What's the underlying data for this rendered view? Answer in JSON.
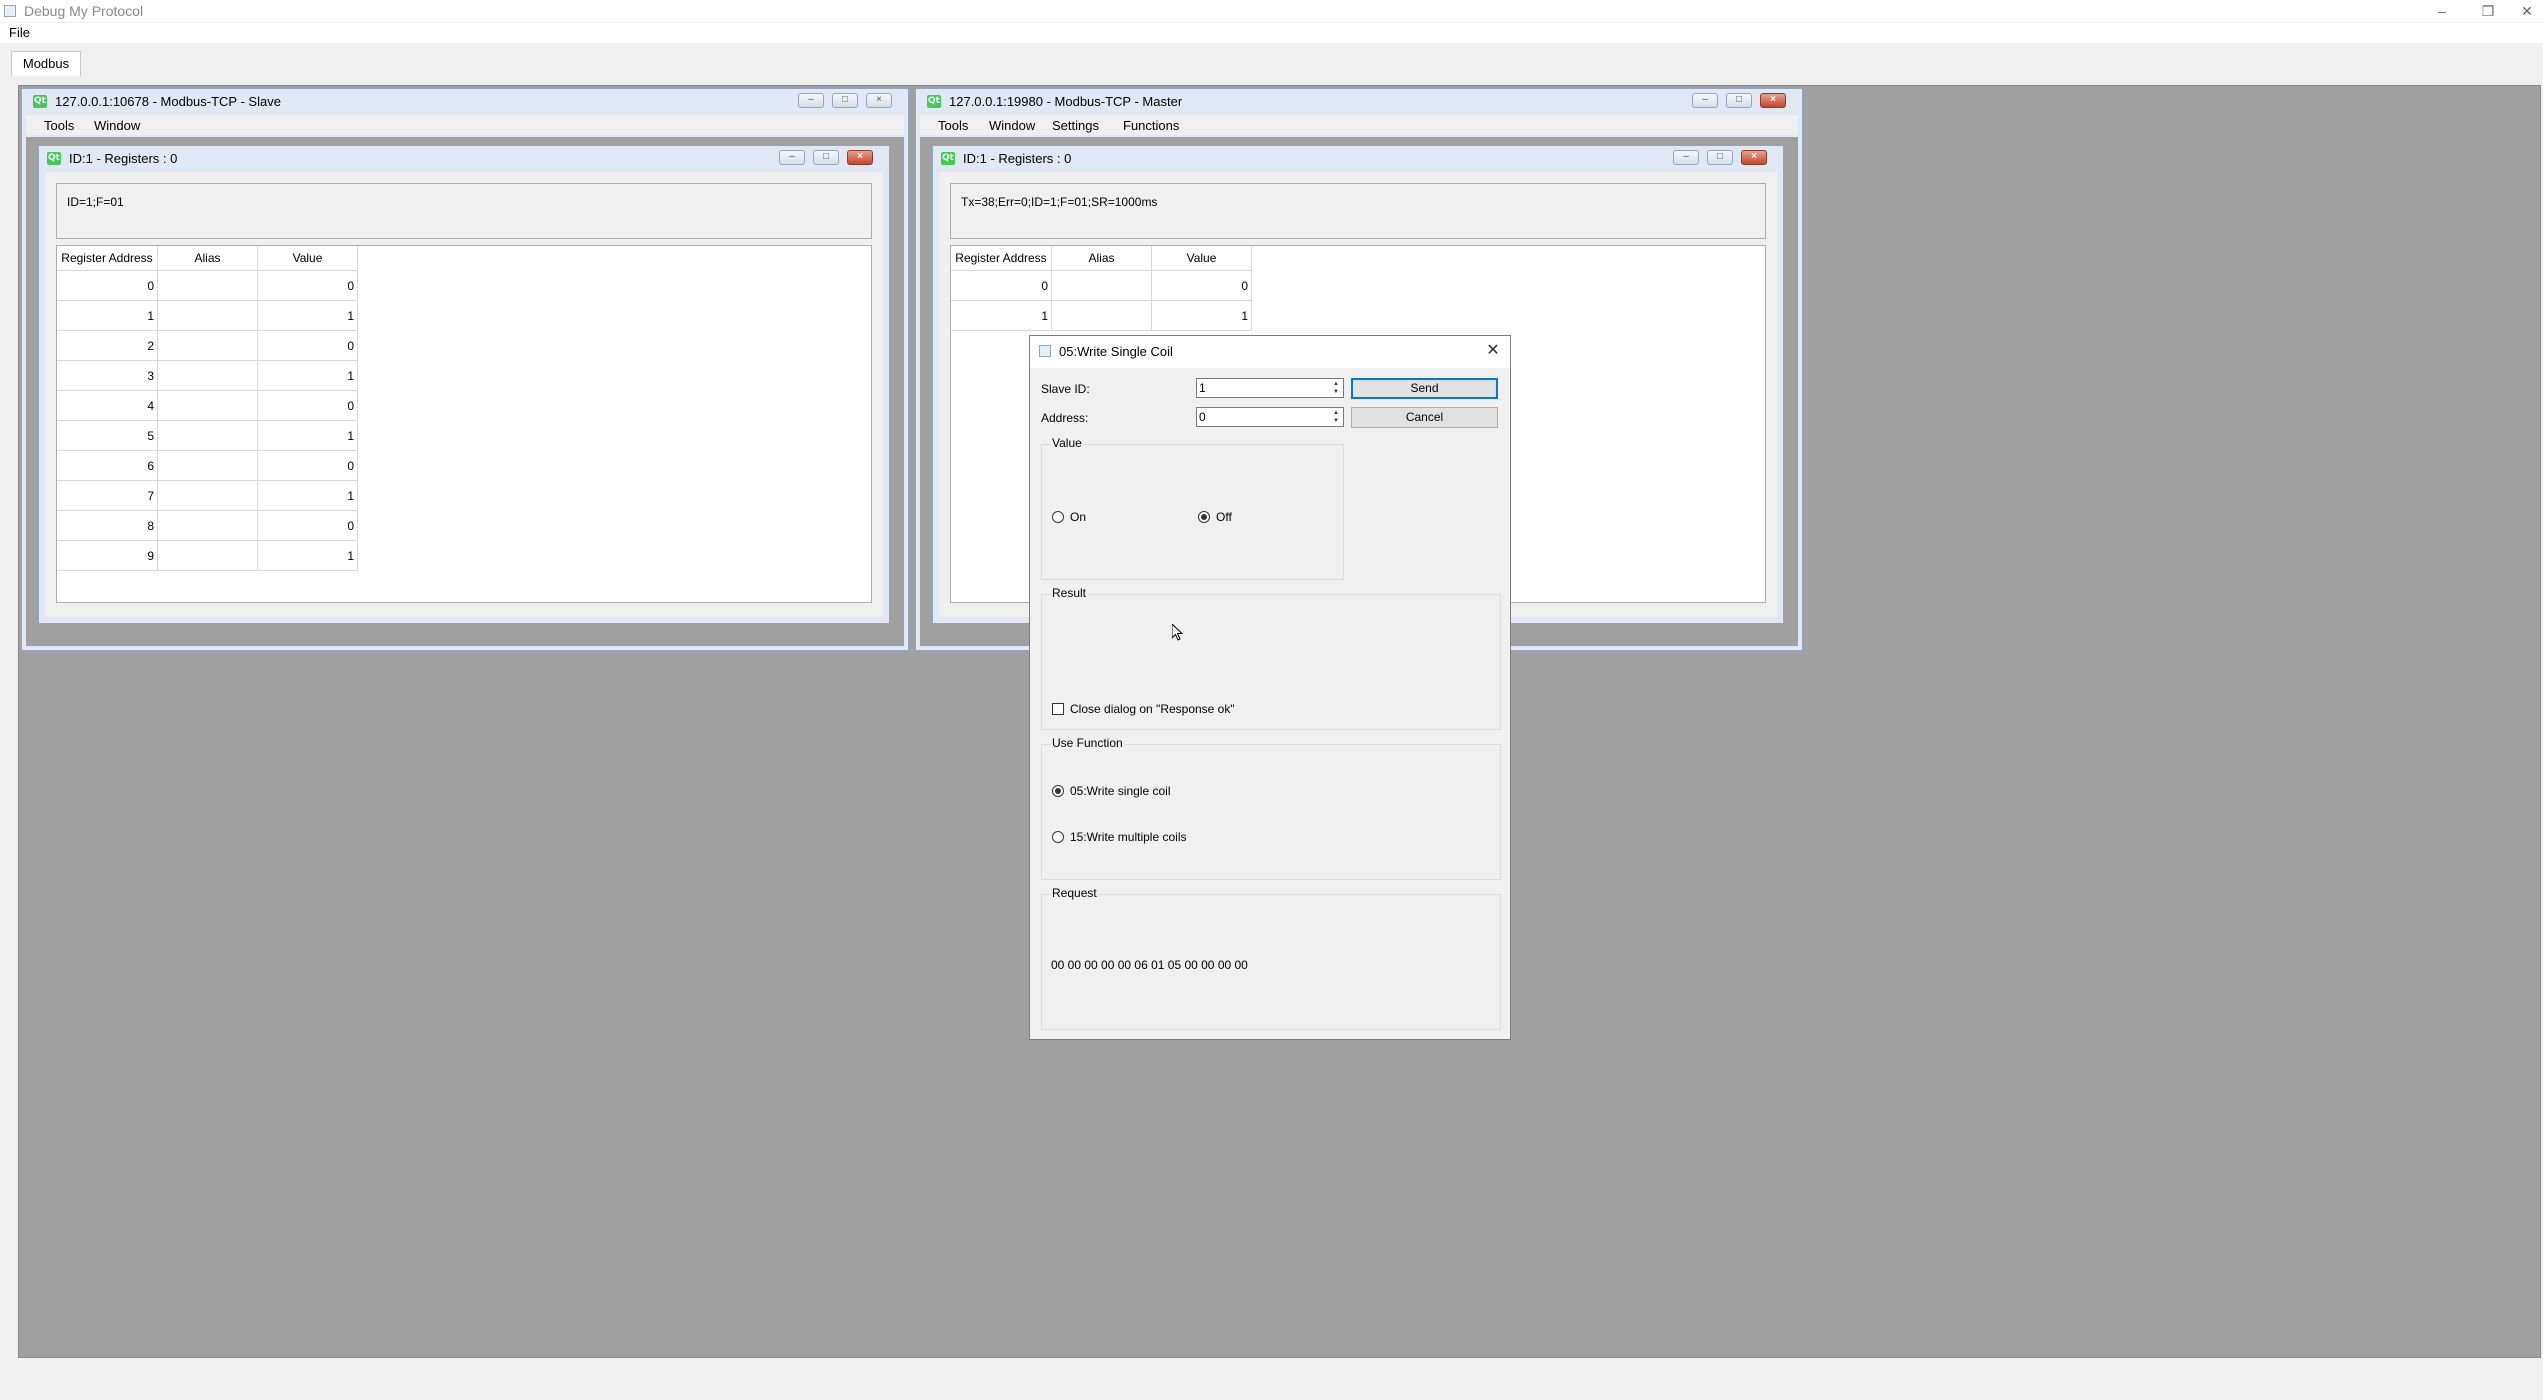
{
  "app": {
    "title": "Debug My Protocol",
    "minimize": "–",
    "restore": "❐",
    "close": "✕"
  },
  "menu": {
    "file": "File"
  },
  "tabs": [
    {
      "label": "Modbus"
    }
  ],
  "slave": {
    "title": "127.0.0.1:10678 - Modbus-TCP - Slave",
    "menu": [
      "Tools",
      "Window"
    ],
    "sub": {
      "title": "ID:1 - Registers : 0",
      "status": "ID=1;F=01",
      "columns": [
        "Register Address",
        "Alias",
        "Value"
      ],
      "rows": [
        {
          "addr": "0",
          "alias": "",
          "value": "0"
        },
        {
          "addr": "1",
          "alias": "",
          "value": "1"
        },
        {
          "addr": "2",
          "alias": "",
          "value": "0"
        },
        {
          "addr": "3",
          "alias": "",
          "value": "1"
        },
        {
          "addr": "4",
          "alias": "",
          "value": "0"
        },
        {
          "addr": "5",
          "alias": "",
          "value": "1"
        },
        {
          "addr": "6",
          "alias": "",
          "value": "0"
        },
        {
          "addr": "7",
          "alias": "",
          "value": "1"
        },
        {
          "addr": "8",
          "alias": "",
          "value": "0"
        },
        {
          "addr": "9",
          "alias": "",
          "value": "1"
        }
      ]
    }
  },
  "master": {
    "title": "127.0.0.1:19980 - Modbus-TCP - Master",
    "menu": [
      "Tools",
      "Window",
      "Settings",
      "Functions"
    ],
    "sub": {
      "title": "ID:1 - Registers : 0",
      "status": "Tx=38;Err=0;ID=1;F=01;SR=1000ms",
      "columns": [
        "Register Address",
        "Alias",
        "Value"
      ],
      "rows": [
        {
          "addr": "0",
          "alias": "",
          "value": "0"
        },
        {
          "addr": "1",
          "alias": "",
          "value": "1"
        }
      ]
    }
  },
  "dialog": {
    "title": "05:Write Single Coil",
    "close": "✕",
    "slave_id_label": "Slave ID:",
    "slave_id_value": "1",
    "address_label": "Address:",
    "address_value": "0",
    "send_label": "Send",
    "cancel_label": "Cancel",
    "value_group": "Value",
    "on_label": "On",
    "off_label": "Off",
    "result_group": "Result",
    "close_on_ok_label": "Close dialog on \"Response ok\"",
    "use_function_group": "Use Function",
    "fn05_label": "05:Write single coil",
    "fn15_label": "15:Write multiple coils",
    "request_group": "Request",
    "request_hex": "00 00 00 00 00 06 01 05 00 00 00 00"
  }
}
